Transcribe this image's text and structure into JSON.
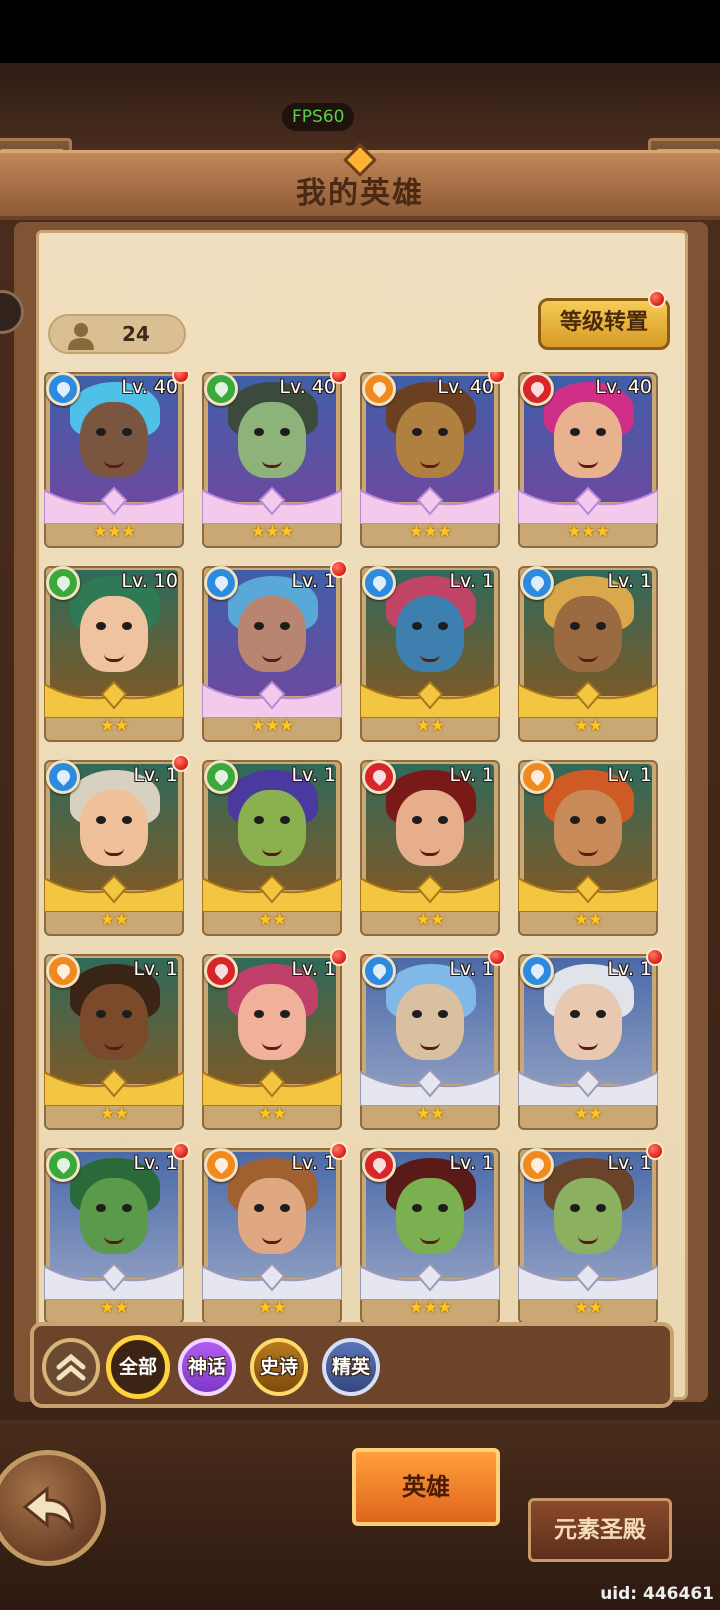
{
  "hud": {
    "fps": "FPS60"
  },
  "header": {
    "title": "我的英雄"
  },
  "hero_count": "24",
  "level_convert": {
    "label": "等级转置",
    "has_notification": true
  },
  "heroes": [
    {
      "level": "Lv. 40",
      "element": "water",
      "element_color": "#2c8be0",
      "rarity": "mythic",
      "stars": "★★★",
      "notify": true,
      "skin": "#7a5540",
      "hair": "#4fc0e8"
    },
    {
      "level": "Lv. 40",
      "element": "wind",
      "element_color": "#3aa83a",
      "rarity": "mythic",
      "stars": "★★★",
      "notify": true,
      "skin": "#8db27a",
      "hair": "#3c4a3c"
    },
    {
      "level": "Lv. 40",
      "element": "earth",
      "element_color": "#f08a1e",
      "rarity": "mythic",
      "stars": "★★★",
      "notify": true,
      "skin": "#b08040",
      "hair": "#6b4020"
    },
    {
      "level": "Lv. 40",
      "element": "fire",
      "element_color": "#d8252a",
      "rarity": "mythic",
      "stars": "★★★",
      "notify": false,
      "skin": "#e9b28f",
      "hair": "#d02f88"
    },
    {
      "level": "Lv. 10",
      "element": "wind",
      "element_color": "#3aa83a",
      "rarity": "epic",
      "stars": "★★",
      "notify": false,
      "skin": "#f0c3a0",
      "hair": "#2f7a54"
    },
    {
      "level": "Lv. 1",
      "element": "water",
      "element_color": "#2c8be0",
      "rarity": "mythic",
      "stars": "★★★",
      "notify": true,
      "skin": "#b88670",
      "hair": "#59a8d8"
    },
    {
      "level": "Lv. 1",
      "element": "water",
      "element_color": "#2c8be0",
      "rarity": "epic",
      "stars": "★★",
      "notify": false,
      "skin": "#3d80b0",
      "hair": "#c04466"
    },
    {
      "level": "Lv. 1",
      "element": "water",
      "element_color": "#2c8be0",
      "rarity": "epic",
      "stars": "★★",
      "notify": false,
      "skin": "#9a6a40",
      "hair": "#d8a84a"
    },
    {
      "level": "Lv. 1",
      "element": "water",
      "element_color": "#2c8be0",
      "rarity": "epic",
      "stars": "★★",
      "notify": true,
      "skin": "#f0c09a",
      "hair": "#d8d0c0"
    },
    {
      "level": "Lv. 1",
      "element": "wind",
      "element_color": "#3aa83a",
      "rarity": "epic",
      "stars": "★★",
      "notify": false,
      "skin": "#8ab050",
      "hair": "#4a3aa0"
    },
    {
      "level": "Lv. 1",
      "element": "fire",
      "element_color": "#d8252a",
      "rarity": "epic",
      "stars": "★★",
      "notify": false,
      "skin": "#e7ae8c",
      "hair": "#7a1a18"
    },
    {
      "level": "Lv. 1",
      "element": "earth",
      "element_color": "#f08a1e",
      "rarity": "epic",
      "stars": "★★",
      "notify": false,
      "skin": "#c98a5a",
      "hair": "#d05a24"
    },
    {
      "level": "Lv. 1",
      "element": "earth",
      "element_color": "#f08a1e",
      "rarity": "epic",
      "stars": "★★",
      "notify": false,
      "skin": "#7a4a2a",
      "hair": "#3a2416"
    },
    {
      "level": "Lv. 1",
      "element": "fire",
      "element_color": "#d8252a",
      "rarity": "epic",
      "stars": "★★",
      "notify": true,
      "skin": "#f0b09a",
      "hair": "#c0406a"
    },
    {
      "level": "Lv. 1",
      "element": "water",
      "element_color": "#2c8be0",
      "rarity": "elite",
      "stars": "★★",
      "notify": true,
      "skin": "#d8c0a0",
      "hair": "#80b8e8"
    },
    {
      "level": "Lv. 1",
      "element": "water",
      "element_color": "#2c8be0",
      "rarity": "elite",
      "stars": "★★",
      "notify": true,
      "skin": "#e8c8b0",
      "hair": "#e0e4ea"
    },
    {
      "level": "Lv. 1",
      "element": "wind",
      "element_color": "#3aa83a",
      "rarity": "elite",
      "stars": "★★",
      "notify": true,
      "skin": "#5a9a4a",
      "hair": "#2a6a3a"
    },
    {
      "level": "Lv. 1",
      "element": "earth",
      "element_color": "#f08a1e",
      "rarity": "elite",
      "stars": "★★",
      "notify": true,
      "skin": "#e0a880",
      "hair": "#a06030"
    },
    {
      "level": "Lv. 1",
      "element": "fire",
      "element_color": "#d8252a",
      "rarity": "elite",
      "stars": "★★★",
      "notify": false,
      "skin": "#7ab050",
      "hair": "#5a1a18"
    },
    {
      "level": "Lv. 1",
      "element": "earth",
      "element_color": "#f08a1e",
      "rarity": "elite",
      "stars": "★★",
      "notify": true,
      "skin": "#8ab060",
      "hair": "#6a4428"
    }
  ],
  "filters": {
    "all": "全部",
    "mythic": "神话",
    "epic": "史诗",
    "elite": "精英"
  },
  "nav": {
    "heroes": "英雄",
    "temple": "元素圣殿"
  },
  "footer": {
    "uid": "uid: 446461"
  },
  "colors": {
    "accent": "#ffd23a",
    "notify": "#e12a1f",
    "fps": "#57d04d"
  }
}
